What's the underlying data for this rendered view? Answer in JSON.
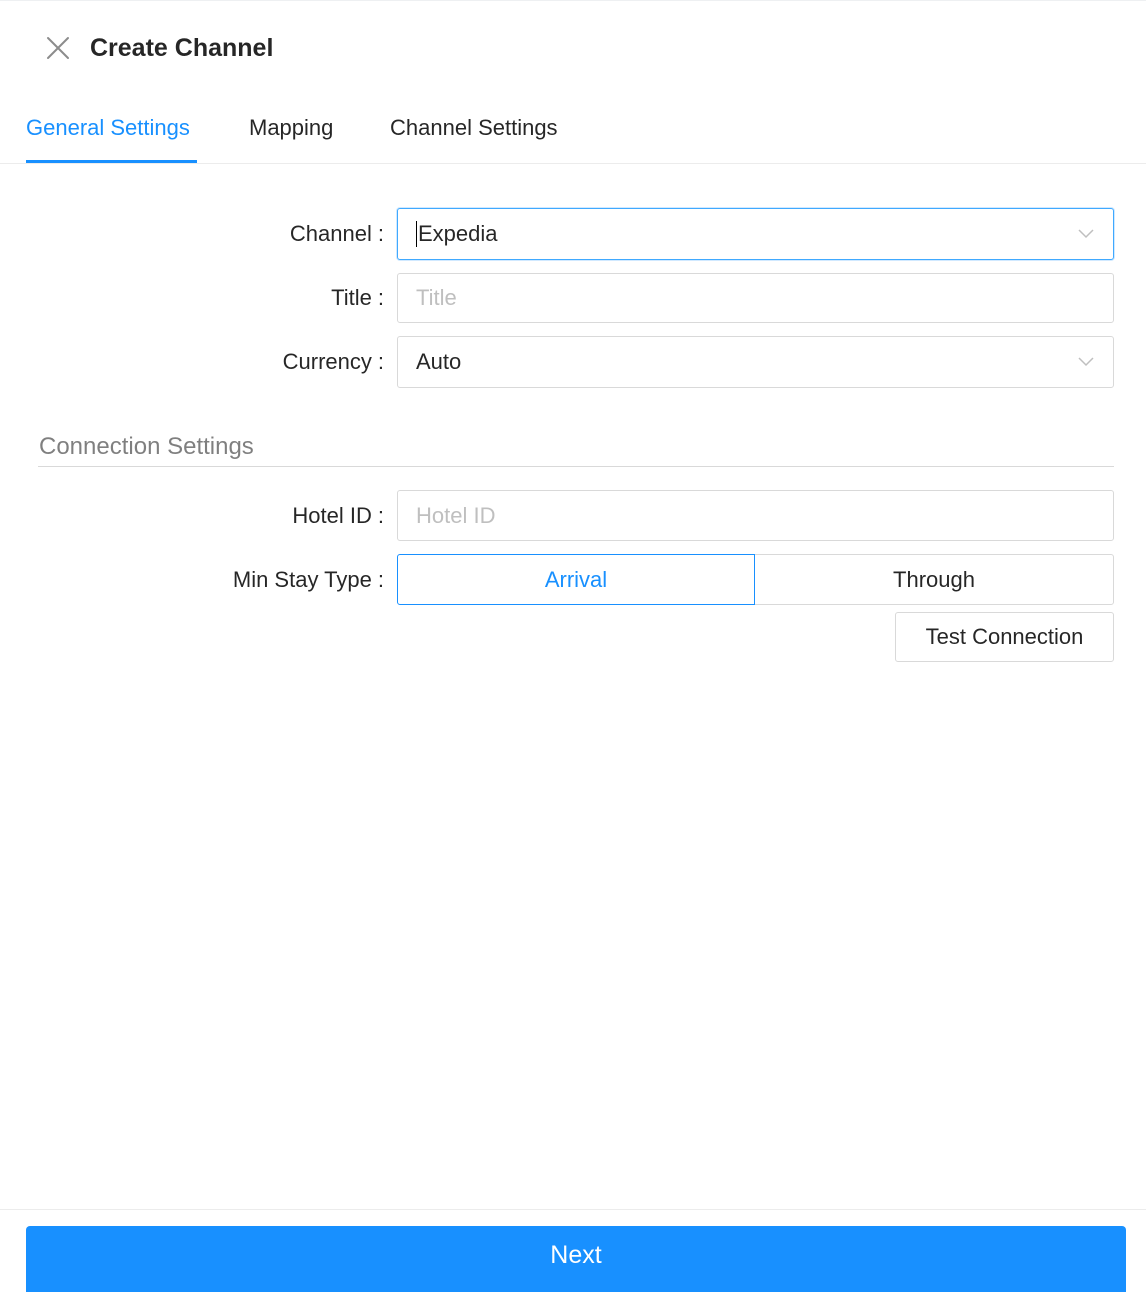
{
  "header": {
    "title": "Create Channel",
    "close_icon": "close-icon"
  },
  "tabs": [
    {
      "label": "General Settings",
      "active": true
    },
    {
      "label": "Mapping",
      "active": false
    },
    {
      "label": "Channel Settings",
      "active": false
    }
  ],
  "form": {
    "channel": {
      "label": "Channel",
      "value": "Expedia"
    },
    "title": {
      "label": "Title",
      "value": "",
      "placeholder": "Title"
    },
    "currency": {
      "label": "Currency",
      "value": "Auto"
    }
  },
  "connection": {
    "section_title": "Connection Settings",
    "hotel_id": {
      "label": "Hotel ID",
      "value": "",
      "placeholder": "Hotel ID"
    },
    "min_stay_type": {
      "label": "Min Stay Type",
      "options": [
        "Arrival",
        "Through"
      ],
      "selected": "Arrival"
    },
    "test_button": "Test Connection"
  },
  "footer": {
    "next_button": "Next"
  },
  "colors": {
    "accent": "#1890ff",
    "border": "#d9d9d9",
    "placeholder": "#bfbfbf"
  },
  "label_colon": ":"
}
